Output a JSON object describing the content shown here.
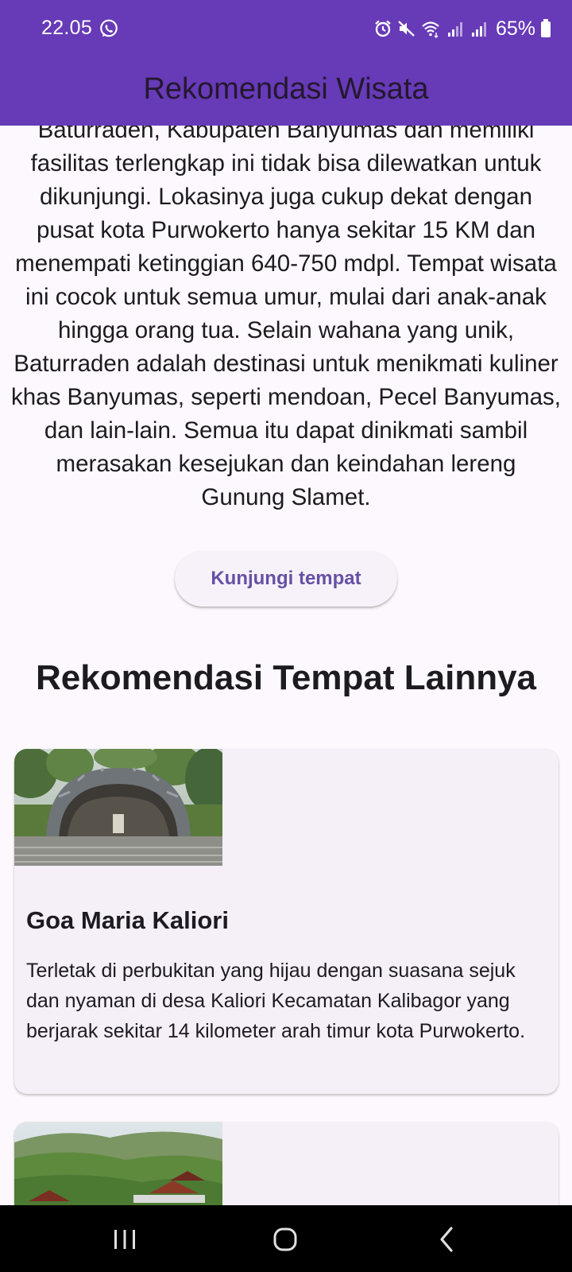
{
  "status_bar": {
    "time": "22.05",
    "battery": "65%",
    "icons": [
      "whatsapp-icon",
      "alarm-icon",
      "mute-icon",
      "wifi-icon",
      "signal-icon",
      "signal-icon",
      "battery-icon"
    ]
  },
  "app_bar": {
    "title": "Rekomendasi Wisata"
  },
  "detail": {
    "description": "Baturraden, Kabupaten Banyumas dan memiliki fasilitas terlengkap ini tidak bisa dilewatkan untuk dikunjungi. Lokasinya juga cukup dekat dengan pusat kota Purwokerto hanya sekitar 15 KM dan menempati ketinggian 640-750 mdpl. Tempat wisata ini cocok untuk semua umur, mulai dari anak-anak hingga orang tua. Selain wahana yang unik, Baturraden adalah destinasi untuk menikmati kuliner khas Banyumas, seperti mendoan, Pecel Banyumas, dan lain-lain. Semua itu dapat dinikmati sambil merasakan kesejukan dan keindahan lereng Gunung Slamet.",
    "visit_button": "Kunjungi tempat"
  },
  "recommendations": {
    "section_title": "Rekomendasi Tempat Lainnya",
    "items": [
      {
        "title": "Goa Maria Kaliori",
        "description": "Terletak di perbukitan yang hijau dengan suasana sejuk dan nyaman di desa Kaliori Kecamatan Kalibagor yang berjarak sekitar 14 kilometer arah timur kota Purwokerto."
      },
      {
        "title": "",
        "description": ""
      }
    ]
  },
  "colors": {
    "app_bar": "#673ab7",
    "background": "#fdf8fd",
    "card": "#f5eff7",
    "button_text": "#6750a4",
    "nav_bar": "#000000"
  },
  "nav_bar": {
    "icons": [
      "recents-icon",
      "home-icon",
      "back-icon"
    ]
  }
}
